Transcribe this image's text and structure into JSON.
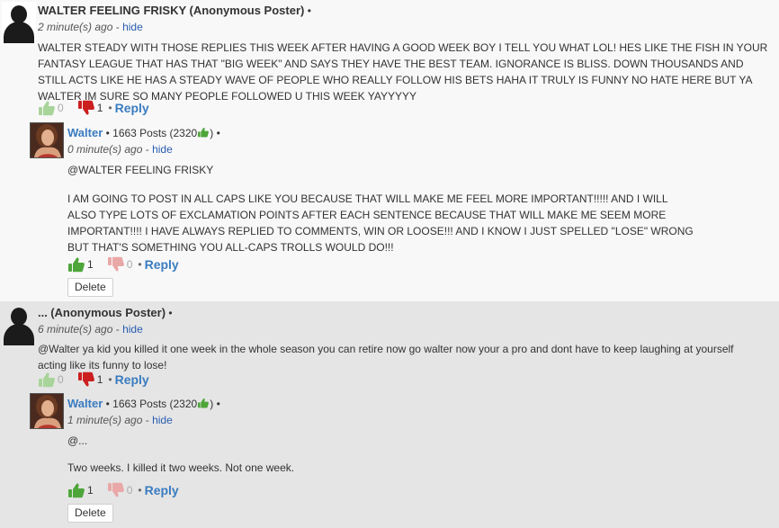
{
  "threads": [
    {
      "comment": {
        "author": "WALTER FEELING FRISKY",
        "poster_tag": "(Anonymous Poster)",
        "bullet": "•",
        "time": "2 minute(s) ago",
        "dash": "-",
        "hide_label": "hide",
        "text_lines": [
          "WALTER STEADY WITH THOSE REPLIES THIS WEEK AFTER HAVING A GOOD WEEK BOY I TELL YOU WHAT LOL! HES LIKE THE FISH IN YOUR",
          "FANTASY LEAGUE THAT HAS THAT \"BIG WEEK\" AND SAYS THEY HAVE THE BEST TEAM. IGNORANCE IS BLISS. DOWN THOUSANDS AND",
          "STILL ACTS LIKE HE HAS A STEADY WAVE OF PEOPLE WHO REALLY FOLLOW HIS BETS HAHA IT TRULY IS FUNNY NO HATE HERE BUT YA",
          "WALTER IM SURE SO MANY PEOPLE FOLLOWED U THIS WEEK YAYYYYY"
        ],
        "upvotes": "0",
        "downvotes": "1",
        "reply_label": "Reply"
      },
      "reply": {
        "author": "Walter",
        "posts": "1663 Posts (2320",
        "posts_close": ")",
        "bullet": "•",
        "time": "0 minute(s) ago",
        "dash": "-",
        "hide_label": "hide",
        "mention": "@WALTER FEELING FRISKY",
        "text_lines": [
          "I AM GOING TO POST IN ALL CAPS LIKE YOU BECAUSE THAT WILL MAKE ME FEEL MORE IMPORTANT!!!!! AND I WILL",
          "ALSO TYPE LOTS OF EXCLAMATION POINTS AFTER EACH SENTENCE BECAUSE THAT WILL MAKE ME SEEM MORE",
          "IMPORTANT!!!! I HAVE ALWAYS REPLIED TO COMMENTS, WIN OR LOOSE!!! AND I KNOW I JUST SPELLED \"LOSE\" WRONG",
          "BUT THAT'S SOMETHING YOU ALL-CAPS TROLLS WOULD DO!!!"
        ],
        "upvotes": "1",
        "downvotes": "0",
        "reply_label": "Reply",
        "delete_label": "Delete"
      }
    },
    {
      "comment": {
        "author": "...",
        "poster_tag": "(Anonymous Poster)",
        "bullet": "•",
        "time": "6 minute(s) ago",
        "dash": "-",
        "hide_label": "hide",
        "text_lines": [
          "@Walter ya kid you killed it one week in the whole season you can retire now go walter now your a pro and dont have to keep laughing at yourself",
          "acting like its funny to lose!"
        ],
        "upvotes": "0",
        "downvotes": "1",
        "reply_label": "Reply"
      },
      "reply": {
        "author": "Walter",
        "posts": "1663 Posts (2320",
        "posts_close": ")",
        "bullet": "•",
        "time": "1 minute(s) ago",
        "dash": "-",
        "hide_label": "hide",
        "mention": "@...",
        "text_lines": [
          "Two weeks. I killed it two weeks. Not one week."
        ],
        "upvotes": "1",
        "downvotes": "0",
        "reply_label": "Reply",
        "delete_label": "Delete"
      }
    }
  ],
  "icons": {
    "upvote": "thumbs-up-icon",
    "downvote": "thumbs-down-icon",
    "reputation": "thumbs-up-icon"
  },
  "colors": {
    "link": "#2a5db0",
    "reply": "#3a7cc0",
    "up_active": "#4ea63a",
    "down_active": "#cc1f1f"
  },
  "bullet_sep": "•"
}
